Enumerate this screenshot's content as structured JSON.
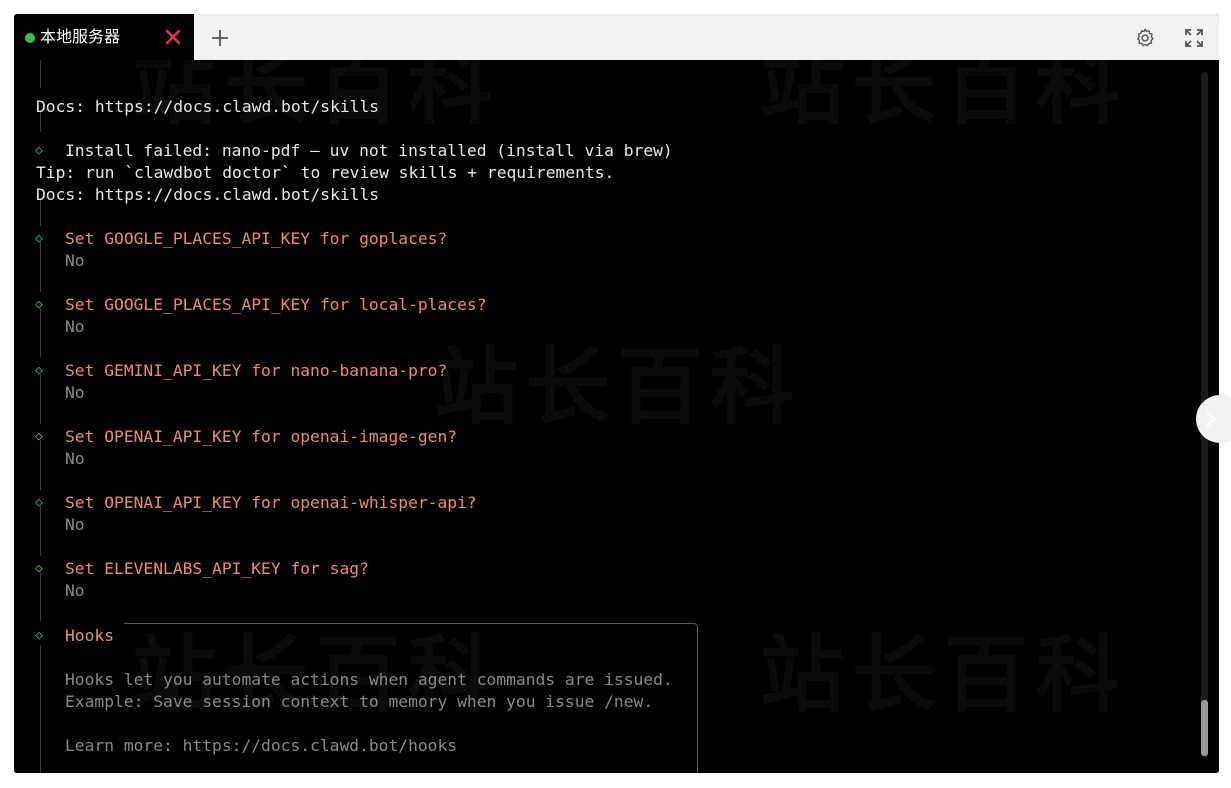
{
  "tab": {
    "title": "本地服务器",
    "status_color": "#2ec24a",
    "close_icon": "close-icon",
    "add_icon": "plus-icon"
  },
  "toolbar": {
    "settings_icon": "gear-icon",
    "fullscreen_icon": "expand-icon"
  },
  "terminal": {
    "lines": {
      "docs_1": "Docs: https://docs.clawd.bot/skills",
      "install_failed": "Install failed: nano-pdf — uv not installed (install via brew)",
      "tip": "Tip: run `clawdbot doctor` to review skills + requirements.",
      "docs_2": "Docs: https://docs.clawd.bot/skills"
    },
    "prompts": [
      {
        "question": "Set GOOGLE_PLACES_API_KEY for goplaces?",
        "answer": "No"
      },
      {
        "question": "Set GOOGLE_PLACES_API_KEY for local-places?",
        "answer": "No"
      },
      {
        "question": "Set GEMINI_API_KEY for nano-banana-pro?",
        "answer": "No"
      },
      {
        "question": "Set OPENAI_API_KEY for openai-image-gen?",
        "answer": "No"
      },
      {
        "question": "Set OPENAI_API_KEY for openai-whisper-api?",
        "answer": "No"
      },
      {
        "question": "Set ELEVENLABS_API_KEY for sag?",
        "answer": "No"
      }
    ],
    "hooks": {
      "title": "Hooks",
      "line1": "Hooks let you automate actions when agent commands are issued.",
      "line2": "Example: Save session context to memory when you issue /new.",
      "line3": "Learn more: https://docs.clawd.bot/hooks"
    }
  },
  "watermark": "站长百科",
  "colors": {
    "prompt_text": "#ee8a70",
    "diamond": "#3fae56",
    "answer": "#8a8a8a",
    "text": "#e8e8e8"
  }
}
